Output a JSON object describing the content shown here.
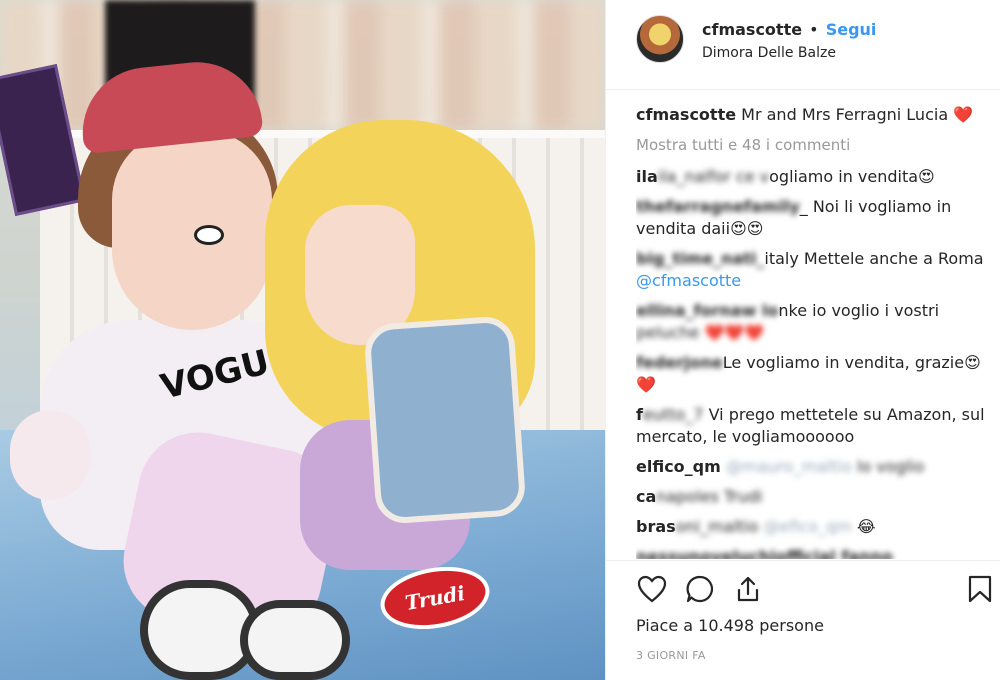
{
  "header": {
    "username": "cfmascotte",
    "dot": "•",
    "follow_label": "Segui",
    "location": "Dimora Delle Balze"
  },
  "caption": {
    "username": "cfmascotte",
    "text": "Mr and Mrs Ferragni Lucia",
    "emoji": "❤️"
  },
  "show_all_label": "Mostra tutti e 48 i commenti",
  "comments": [
    {
      "blurred": "ila_nalfor ce v",
      "text": "ogliamo in vendita😍"
    },
    {
      "blurred": "thefarragnefamily",
      "text": "_ Noi li vogliamo in vendita daii😍😍"
    },
    {
      "blurred": "big_time_nati_",
      "text": "italy Mettele anche a Roma",
      "mention": "@cfmascotte"
    },
    {
      "blurred": "ellina_fornaw lo",
      "text": "nke io voglio i vostri",
      "blurred2": "peluche",
      "tail": "❤️❤️❤️"
    },
    {
      "blurred": "federjone",
      "text": "Le vogliamo in vendita, grazie😍❤️"
    },
    {
      "blurred": "f",
      "blurred_mid": "eutto_7",
      "text": "Vi prego mettetele su Amazon, sul mercato, le vogliamoooooo"
    },
    {
      "blurred": "elfico_qm",
      "blurred_mention": "@mauro_maltio",
      "blurred_tail": "lo voglio",
      "text": ""
    },
    {
      "blurred": "ca",
      "blurred_tail": "napoles Trudi",
      "text": ""
    },
    {
      "blurred": "bras",
      "blurred_mid": "oni_maltio",
      "blurred_mention": "@efico_qm",
      "text": "😂"
    },
    {
      "blurred": "nessunoveluchiofficial fanno",
      "text": ""
    }
  ],
  "likes_text": "Piace a 10.498 persone",
  "time_text": "3 GIORNI FA",
  "photo": {
    "doll_shirt_text": "VOGU",
    "badge_text": "Trudi"
  },
  "icons": [
    "heart-icon",
    "comment-icon",
    "share-icon",
    "bookmark-icon"
  ],
  "colors": {
    "link": "#3897f0",
    "muted": "#999999",
    "text": "#262626",
    "heart": "#e0224d"
  }
}
